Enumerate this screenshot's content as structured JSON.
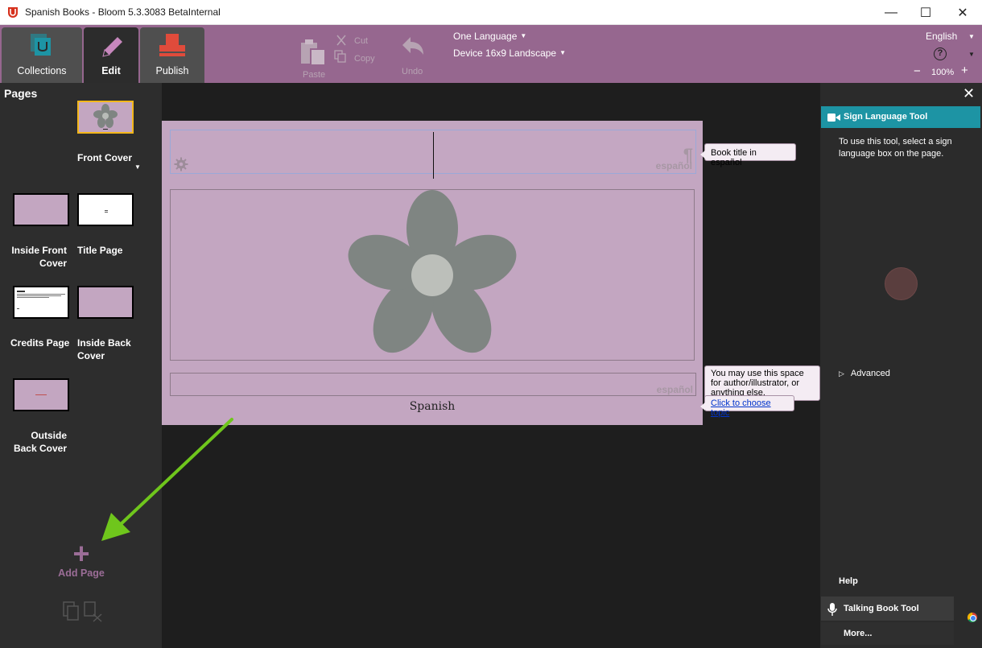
{
  "window": {
    "title": "Spanish Books - Bloom 5.3.3083 BetaInternal",
    "minimize": "—",
    "maximize": "☐",
    "close": "✕"
  },
  "tabs": {
    "collections": "Collections",
    "edit": "Edit",
    "publish": "Publish"
  },
  "toolbar": {
    "paste": "Paste",
    "cut": "Cut",
    "copy": "Copy",
    "undo": "Undo",
    "language_mode": "One Language",
    "layout": "Device 16x9 Landscape",
    "ui_language": "English",
    "help": "?",
    "zoom_out": "−",
    "zoom_level": "100%",
    "zoom_in": "+"
  },
  "pages_panel": {
    "header": "Pages",
    "pages": [
      {
        "label": "Front Cover"
      },
      {
        "label": "Inside Front Cover"
      },
      {
        "label": "Title Page"
      },
      {
        "label": "Credits Page"
      },
      {
        "label": "Inside Back Cover"
      },
      {
        "label": "Outside Back Cover"
      }
    ],
    "add_page": "Add Page"
  },
  "page": {
    "title_language_tag": "español",
    "credits_language_tag": "español",
    "language_name": "Spanish",
    "hints": {
      "title": "Book title in español",
      "credits": "You may use this space for author/illustrator, or anything else.",
      "topic_link": "Click to choose topic"
    }
  },
  "tool_panel": {
    "close": "✕",
    "active_tool": "Sign Language Tool",
    "instructions": "To use this tool, select a sign language box on the page.",
    "advanced": "Advanced",
    "help": "Help",
    "other_tool": "Talking Book Tool",
    "more": "More..."
  },
  "colors": {
    "toolbar_purple": "#96678f",
    "page_background": "#c3a6c1",
    "tool_header_teal": "#1d94a4",
    "arrow_green": "#6fc61c"
  }
}
